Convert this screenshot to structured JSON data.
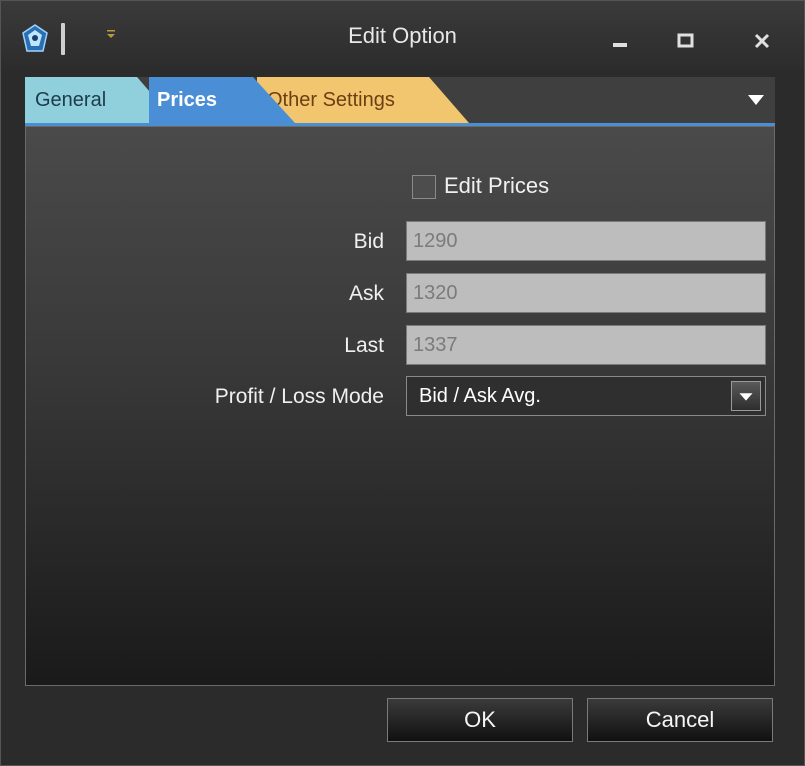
{
  "window": {
    "title": "Edit Option"
  },
  "tabs": [
    {
      "label": "General",
      "color": "#8fd0dc"
    },
    {
      "label": "Prices",
      "color": "#4a8fd6",
      "active": true
    },
    {
      "label": "Other Settings",
      "color": "#f2c66f"
    }
  ],
  "prices": {
    "edit_prices_label": "Edit Prices",
    "edit_prices_checked": false,
    "bid_label": "Bid",
    "bid_value": "1290",
    "ask_label": "Ask",
    "ask_value": "1320",
    "last_label": "Last",
    "last_value": "1337",
    "pl_mode_label": "Profit / Loss Mode",
    "pl_mode_value": "Bid / Ask Avg."
  },
  "buttons": {
    "ok_label": "OK",
    "cancel_label": "Cancel"
  },
  "icons": {
    "app": "app-logo-icon",
    "quick_access": "quick-access-dropdown-icon",
    "minimize": "minimize-icon",
    "maximize": "maximize-icon",
    "close": "close-icon",
    "tab_overflow": "chevron-down-icon",
    "combo_arrow": "chevron-down-icon"
  },
  "colors": {
    "accent": "#4b8fd1"
  }
}
